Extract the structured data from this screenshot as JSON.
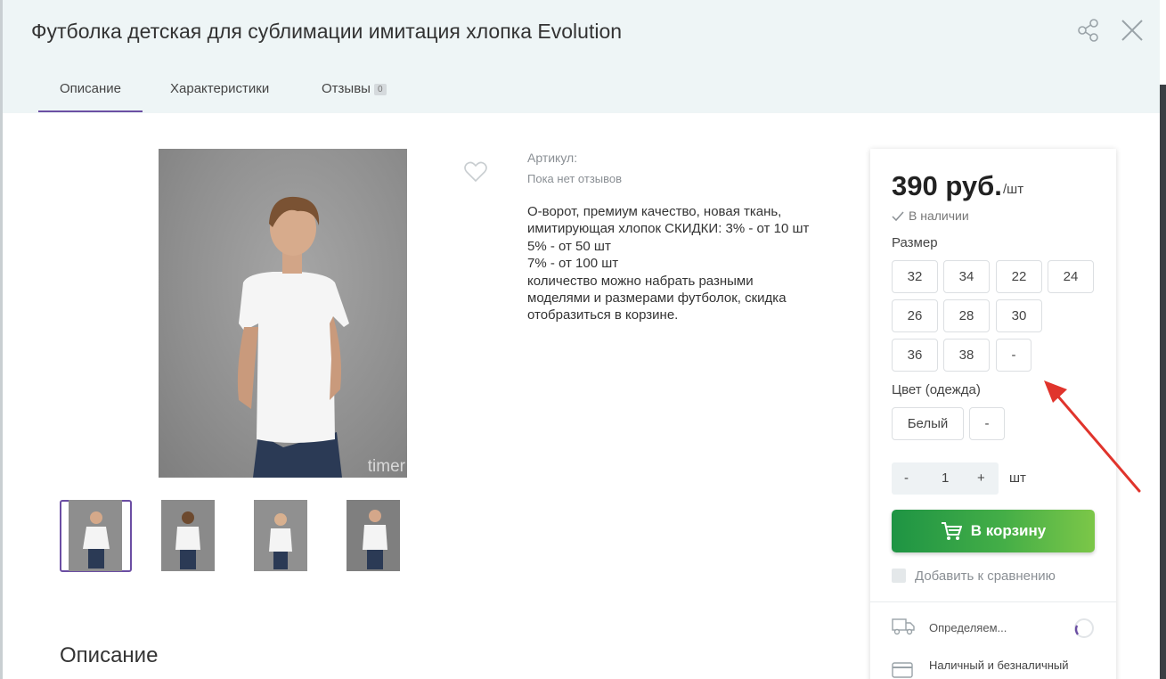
{
  "header": {
    "title": "Футболка детская для сублимации имитация хлопка Evolution",
    "tabs": [
      {
        "label": "Описание",
        "active": true
      },
      {
        "label": "Характеристики"
      },
      {
        "label": "Отзывы",
        "badge": "0"
      }
    ]
  },
  "gallery": {
    "watermark": "timer",
    "thumbnails": 4
  },
  "info": {
    "article_label": "Артикул:",
    "reviews_text": "Пока нет отзывов",
    "description_lines": [
      "О-ворот, премиум качество, новая ткань,",
      "имитирующая хлопок СКИДКИ: 3% - от 10 шт",
      "5% - от 50 шт",
      "7% - от 100 шт",
      "количество можно набрать разными",
      "моделями и размерами футболок, скидка",
      "отобразиться в корзине."
    ]
  },
  "section_title": "Описание",
  "buy": {
    "price": "390 руб.",
    "unit": "/шт",
    "stock": "В наличии",
    "size_label": "Размер",
    "sizes": [
      "32",
      "34",
      "22",
      "24",
      "26",
      "28",
      "30",
      "36",
      "38",
      "-"
    ],
    "color_label": "Цвет (одежда)",
    "colors": [
      "Белый",
      "-"
    ],
    "qty_minus": "-",
    "qty": "1",
    "qty_plus": "+",
    "qty_unit": "шт",
    "cart_button": "В корзину",
    "compare": "Добавить к сравнению",
    "delivery": "Определяем...",
    "payment": "Наличный и безналичный"
  },
  "colors": {
    "accent": "#6b4ea3",
    "cart_green": "#44ae47",
    "header_bg": "#eef5f6",
    "arrow": "#e0342c"
  }
}
